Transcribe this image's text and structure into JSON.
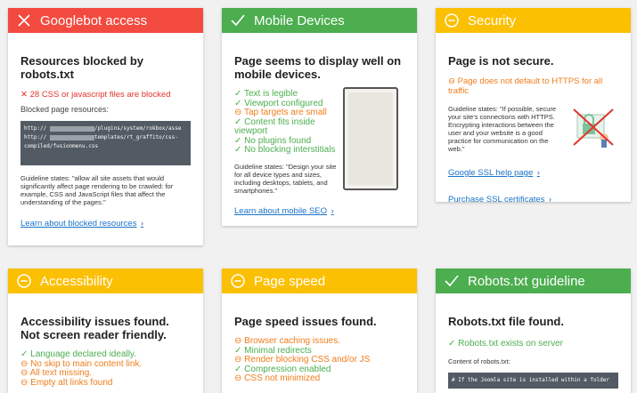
{
  "cards": {
    "googlebot": {
      "title": "Googlebot access",
      "heading": "Resources blocked by robots.txt",
      "alert": "28 CSS or javascript files are blocked",
      "blocked_label": "Blocked page resources:",
      "code_lines": [
        "http://",
        "/plugins/system/rokbox/asse",
        "http://",
        "templates/rt_graffito/css-",
        "compiled/fusionmenu.css"
      ],
      "guideline": "Guideline states: \"allow all site assets that would significantly affect page rendering to be crawled: for example, CSS and JavaScript files that affect the understanding of the pages.\"",
      "link": "Learn about blocked resources"
    },
    "mobile": {
      "title": "Mobile Devices",
      "heading": "Page seems to display well on mobile devices.",
      "checks": [
        {
          "icon": "✓",
          "text": "Text is legible",
          "status": "ok"
        },
        {
          "icon": "✓",
          "text": "Viewport configured",
          "status": "ok"
        },
        {
          "icon": "⊖",
          "text": "Tap targets are small",
          "status": "warn"
        },
        {
          "icon": "✓",
          "text": "Content fits inside viewport",
          "status": "ok"
        },
        {
          "icon": "✓",
          "text": "No plugins found",
          "status": "ok"
        },
        {
          "icon": "✓",
          "text": "No blocking interstitials",
          "status": "ok"
        }
      ],
      "guideline": "Guideline states: \"Design your site for all device types and sizes, including desktops, tablets, and smartphones.\"",
      "link": "Learn about mobile SEO"
    },
    "security": {
      "title": "Security",
      "heading": "Page is not secure.",
      "alert": "Page does not default to HTTPS for all traffic",
      "guideline": "Guideline states: \"If possible, secure your site's connections with HTTPS. Encrypting interactions between the user and your website is a good practice for communication on the web.\"",
      "link1": "Google SSL help page",
      "link2": "Purchase SSL certificates"
    },
    "accessibility": {
      "title": "Accessibility",
      "heading": "Accessibility issues found. Not screen reader friendly.",
      "checks": [
        {
          "icon": "✓",
          "text": "Language declared ideally.",
          "status": "ok"
        },
        {
          "icon": "⊖",
          "text": "No skip to main content link.",
          "status": "warn"
        },
        {
          "icon": "⊖",
          "text": "All text missing.",
          "status": "warn"
        },
        {
          "icon": "⊖",
          "text": "Empty alt links found",
          "status": "warn"
        }
      ]
    },
    "speed": {
      "title": "Page speed",
      "heading": "Page speed issues found.",
      "checks": [
        {
          "icon": "⊖",
          "text": "Browser caching issues.",
          "status": "warn"
        },
        {
          "icon": "✓",
          "text": "Minimal redirects",
          "status": "ok"
        },
        {
          "icon": "⊖",
          "text": "Render blocking CSS and/or JS",
          "status": "warn"
        },
        {
          "icon": "✓",
          "text": "Compression enabled",
          "status": "ok"
        },
        {
          "icon": "⊖",
          "text": "CSS not minimized",
          "status": "warn"
        }
      ]
    },
    "robots": {
      "title": "Robots.txt guideline",
      "heading": "Robots.txt file found.",
      "check": "Robots.txt exists on server",
      "content_label": "Content of robots.txt:",
      "code": "# If the Joomla site is installed within a folder"
    }
  },
  "colors": {
    "red": "#f34a3f",
    "green": "#4cae4f",
    "amber": "#fcc002",
    "link": "#1a73c8"
  }
}
